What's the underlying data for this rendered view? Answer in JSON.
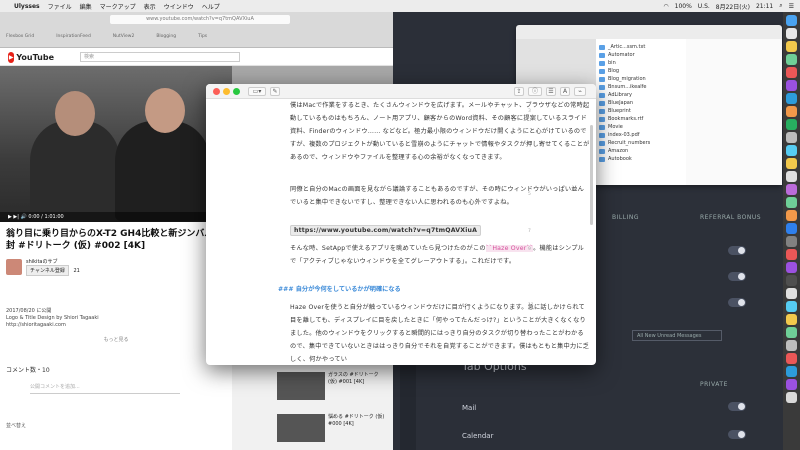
{
  "menubar": {
    "app": "Ulysses",
    "items": [
      "ファイル",
      "編集",
      "マークアップ",
      "表示",
      "ウインドウ",
      "ヘルプ"
    ],
    "battery": "100%",
    "lang": "U.S.",
    "date": "8月22日(火)",
    "time": "21:11"
  },
  "browser": {
    "url": "www.youtube.com/watch?v=q7tmQAVXiuA",
    "bookmarks": [
      "Flexbox Grid",
      "InspirationFeed",
      "NutView2",
      "Blogging",
      "Tips"
    ]
  },
  "youtube": {
    "logo": "YouTube",
    "search_placeholder": "検索",
    "title": "翁り目に乗り目からのX-T2 GH4比較と新ジンバル開封 #ドリトーク (仮) #002 [4K]",
    "channel": "shikitaのサブ",
    "subscribe": "チャンネル登録",
    "sub_count": "21",
    "published": "2017/08/20 に公開",
    "desc_line1": "Logo & Title Design by Shiori Tagaaki",
    "desc_line2": "http://shioritagaaki.com",
    "show_more": "もっと見る",
    "comments_label": "コメント数・10",
    "comment_placeholder": "公開コメントを追加...",
    "controls": "▶ ▶| 🔊  0:00 / 1:01:00",
    "sidebar": [
      {
        "title": "ガラスの #ドリトーク (仮) #001 [4K]",
        "meta": "shikitaのサブ"
      },
      {
        "title": "悩める #ドリトーク (仮) #000 [4K]",
        "meta": "視聴回数 87回"
      }
    ],
    "sort": "並べ替え"
  },
  "finder": {
    "items": [
      "_Artic...ssm.txt",
      "Automator",
      "bin",
      "Blog",
      "Blog_migration",
      "Bnsum...ikealfe",
      "AdLibrary",
      "BlueJapan",
      "Blueprint",
      "Bookmarks.rtf",
      "Movie",
      "index-03.pdf",
      "Recruit_numbers",
      "Amazon",
      "Autobook"
    ]
  },
  "settings": {
    "col1": "BILLING",
    "col2": "REFERRAL BONUS",
    "col3": "PRIVATE",
    "dropdown": "All New Unread Messages",
    "section": "Tab Options",
    "opt1": "Mail",
    "opt2": "Calendar"
  },
  "editor": {
    "para1": "僕はMacで作業をするとき、たくさんウィンドウを広げます。メールやチャット、ブラウザなどの常時起動しているものはもちろん、ノート用アプリ、顧客からのWord資料、その顧客に提案しているスライド資料、Finderのウィンドウ…… などなど。極力最小限のウィンドウだけ開くようにと心がけているのですが、複数のプロジェクトが動いていると雪崩のようにチャットで情報やタスクが押し寄せてくることがあるので、ウィンドウやファイルを整理する心の余裕がなくなってきます。",
    "para2": "同僚と自分のMacの画面を見ながら議論することもあるのですが、その時にウィンドウがいっぱい並んでいると集中できないですし、整理できない人に思われるのも心外ですよね。",
    "url": "https://www.youtube.com/watch?v=q7tmQAVXiuA",
    "para3_pre": "そんな時、SetAppで使えるアプリを眺めていたら見つけたのがこの",
    "para3_hl": "``Haze Over``",
    "para3_post": "。機能はシンプルで「アクティブじゃないウィンドウを全てグレーアウトする」。これだけです。",
    "heading": "### 自分が今何をしているかが明確になる",
    "para4": "Haze Overを使うと自分が触っているウィンドウだけに目が行くようになります。急に話しかけられて目を離しても、ディスプレイに目を戻したときに「何やってたんだっけ?」ということが大きくなくなりました。他のウィンドウをクリックすると瞬間的にはっきり自分のタスクが切り替わったことがわかるので、集中できていないときははっきり自分でそれを自覚することができます。僕はもともと集中力に乏しく、何かやってい",
    "lines": [
      "3",
      "5",
      "7",
      "9",
      "11"
    ]
  },
  "colors": {
    "accent": "#3b8ad8",
    "highlight": "#d64f9b",
    "youtube_red": "#e62117"
  }
}
